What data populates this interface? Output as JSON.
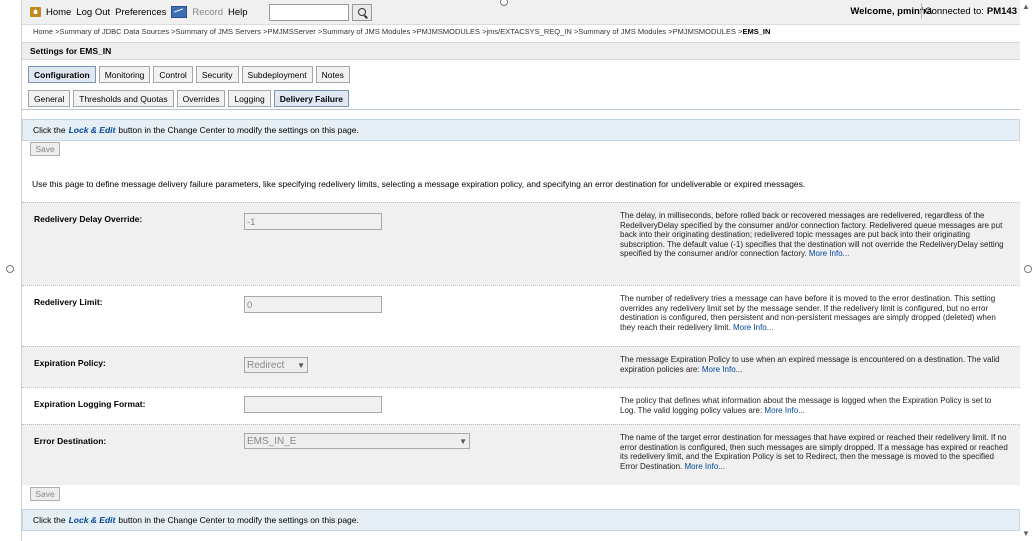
{
  "toolbar": {
    "home": "Home",
    "logout": "Log Out",
    "preferences": "Preferences",
    "record": "Record",
    "help": "Help",
    "search_value": "",
    "welcome": "Welcome, pminfra",
    "connected_label": "Connected to:",
    "connected_server": "PM143"
  },
  "breadcrumb": {
    "path": "Home >Summary of JDBC Data Sources >Summary of JMS Servers >PMJMSServer >Summary of JMS Modules >PMJMSMODULES >jms/EXTACSYS_REQ_IN >Summary of JMS Modules >PMJMSMODULES >",
    "current": "EMS_IN"
  },
  "settings_title": "Settings for EMS_IN",
  "tabs": [
    "Configuration",
    "Monitoring",
    "Control",
    "Security",
    "Subdeployment",
    "Notes"
  ],
  "subtabs": [
    "General",
    "Thresholds and Quotas",
    "Overrides",
    "Logging",
    "Delivery Failure"
  ],
  "info": {
    "prefix": "Click the",
    "link": "Lock & Edit",
    "suffix": "button in the Change Center to modify the settings on this page."
  },
  "save_label": "Save",
  "intro": "Use this page to define message delivery failure parameters, like specifying redelivery limits, selecting a message expiration policy, and specifying an error destination for undeliverable or expired messages.",
  "more_info": "More Info...",
  "fields": [
    {
      "label": "Redelivery Delay Override:",
      "value": "-1",
      "description": "The delay, in milliseconds, before rolled back or recovered messages are redelivered, regardless of the RedeliveryDelay specified by the consumer and/or connection factory. Redelivered queue messages are put back into their originating destination; redelivered topic messages are put back into their originating subscription. The default value (-1) specifies that the destination will not override the RedeliveryDelay setting specified by the consumer and/or connection factory."
    },
    {
      "label": "Redelivery Limit:",
      "value": "0",
      "description": "The number of redelivery tries a message can have before it is moved to the error destination. This setting overrides any redelivery limit set by the message sender. If the redelivery limit is configured, but no error destination is configured, then persistent and non-persistent messages are simply dropped (deleted) when they reach their redelivery limit."
    },
    {
      "label": "Expiration Policy:",
      "value": "Redirect",
      "description": "The message Expiration Policy to use when an expired message is encountered on a destination. The valid expiration policies are:"
    },
    {
      "label": "Expiration Logging Format:",
      "value": "",
      "description": "The policy that defines what information about the message is logged when the Expiration Policy is set to Log. The valid logging policy values are:"
    },
    {
      "label": "Error Destination:",
      "value": "EMS_IN_E",
      "description": "The name of the target error destination for messages that have expired or reached their redelivery limit. If no error destination is configured, then such messages are simply dropped. If a message has expired or reached its redelivery limit, and the Expiration Policy is set to Redirect, then the message is moved to the specified Error Destination."
    }
  ],
  "colors": {
    "link": "#00469c",
    "info_bar": "#e6eef6",
    "row_bg": "#f0f0f0"
  }
}
